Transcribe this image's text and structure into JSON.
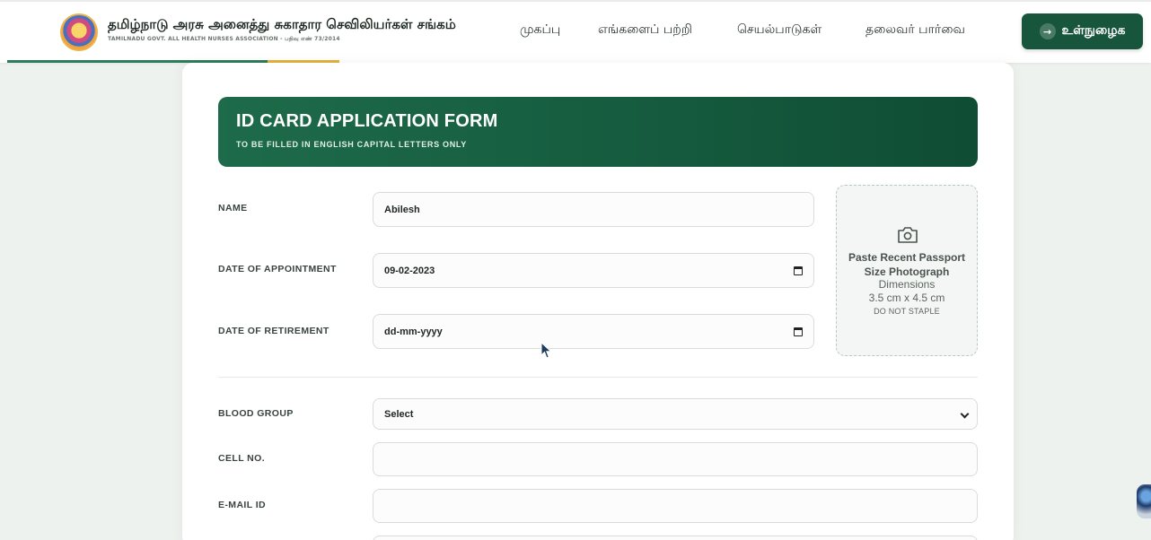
{
  "header": {
    "brand_title": "தமிழ்நாடு அரசு அனைத்து சுகாதார செவிலியர்கள் சங்கம்",
    "brand_subtitle": "TAMILNADU GOVT. ALL HEALTH NURSES ASSOCIATION - பதிவு எண் 73/2014",
    "nav": [
      "முகப்பு",
      "எங்களைப் பற்றி",
      "செயல்பாடுகள்",
      "தலைவர் பார்வை"
    ],
    "login_label": "உள்நுழைக",
    "login_arrow": "→"
  },
  "form": {
    "title": "ID CARD APPLICATION FORM",
    "subtitle": "TO BE FILLED IN ENGLISH CAPITAL LETTERS ONLY",
    "fields": {
      "name": {
        "label": "NAME",
        "value": "Abilesh"
      },
      "date_of_appointment": {
        "label": "DATE OF APPOINTMENT",
        "value": "09-02-2023"
      },
      "date_of_retirement": {
        "label": "DATE OF RETIREMENT",
        "value": "dd-mm-yyyy"
      },
      "blood_group": {
        "label": "BLOOD GROUP",
        "value": "Select"
      },
      "cell_no": {
        "label": "CELL NO.",
        "value": ""
      },
      "email_id": {
        "label": "E-MAIL ID",
        "value": ""
      }
    },
    "photo": {
      "title": "Paste Recent Passport Size Photograph",
      "dimensions_label": "Dimensions",
      "dimensions": "3.5 cm x 4.5 cm",
      "note": "DO NOT STAPLE",
      "icon": "camera-icon"
    }
  },
  "colors": {
    "brand_green": "#17553c",
    "header_gradient_start": "#1d6b4a",
    "accent_gold": "#e2b33c",
    "background": "#eef2ef"
  }
}
